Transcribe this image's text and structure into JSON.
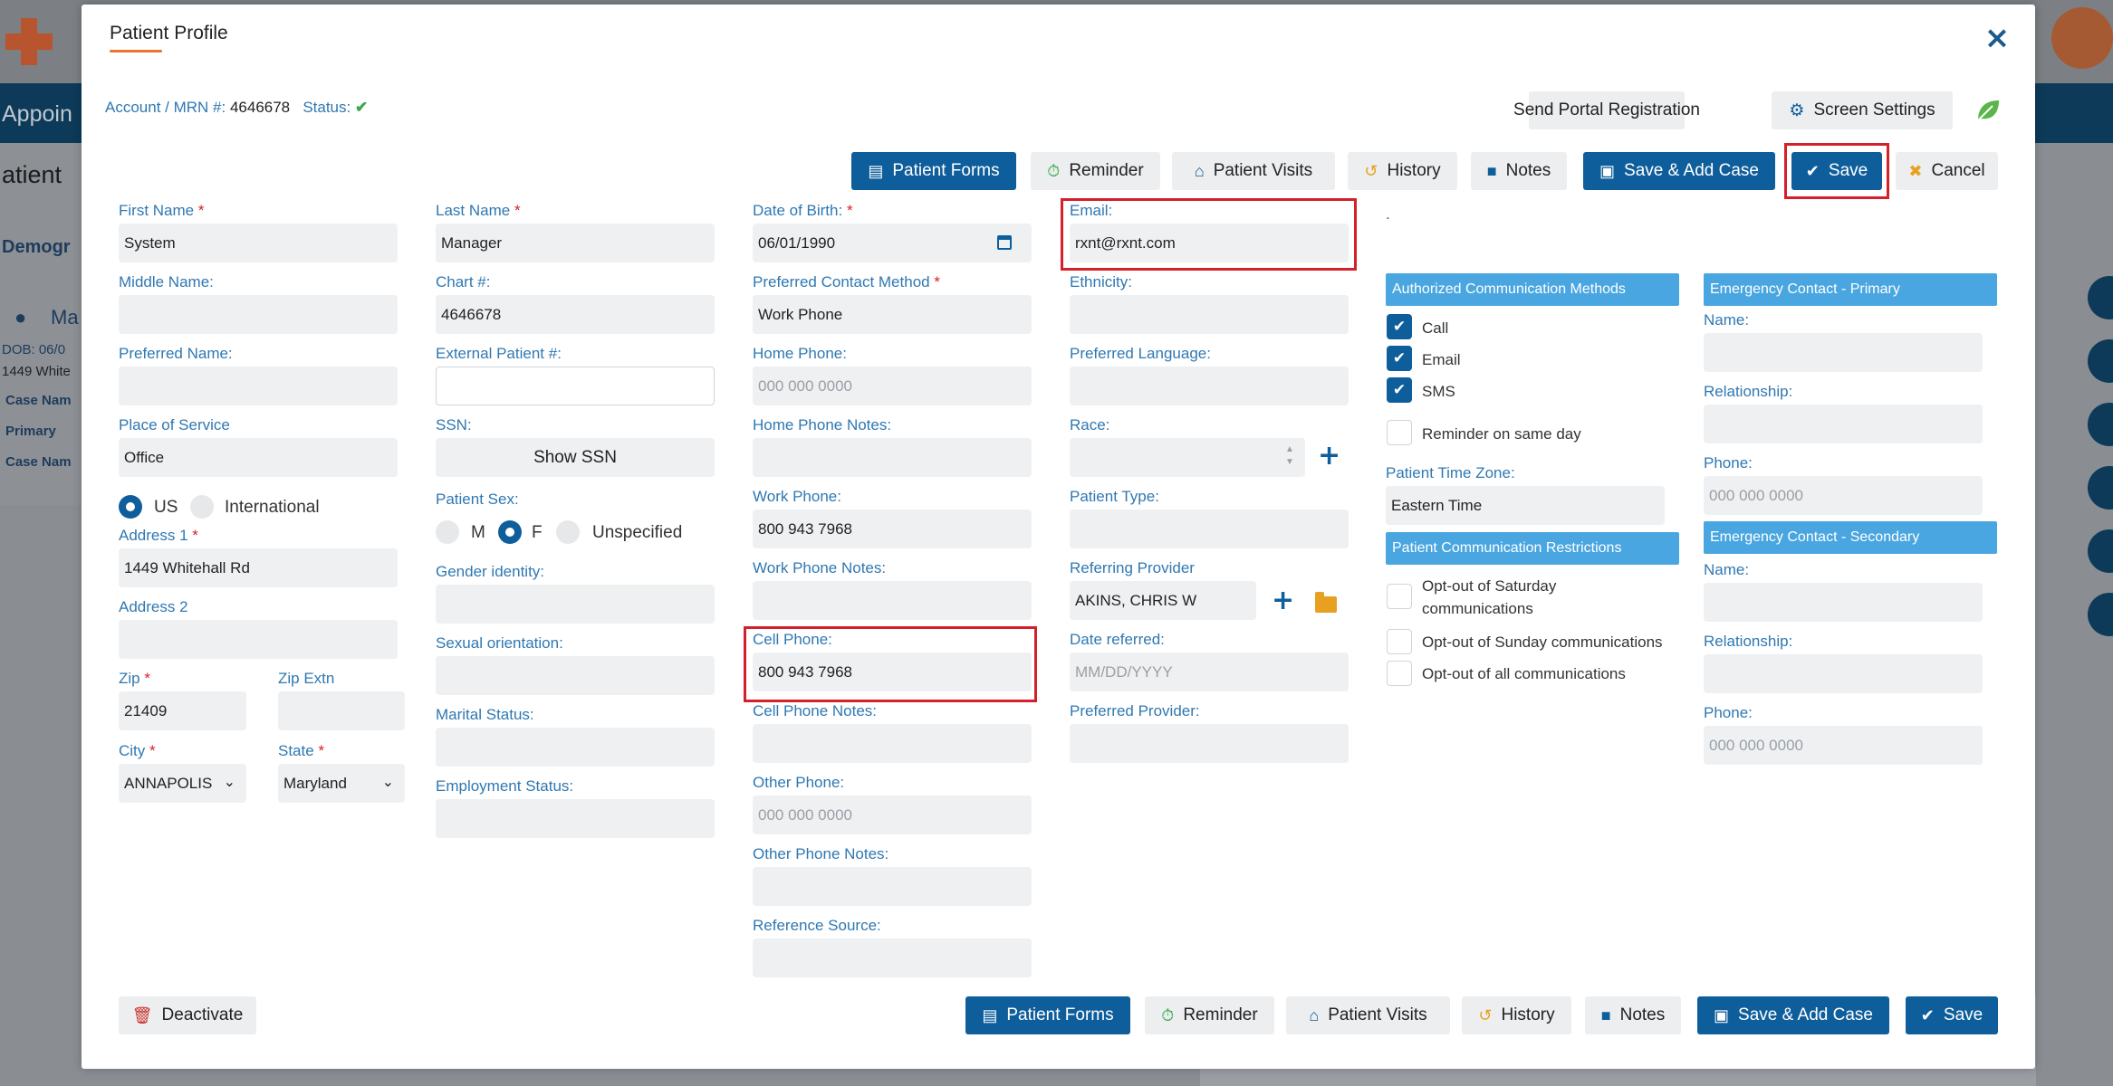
{
  "background": {
    "nav_text": "Appoin",
    "page_title": "atient",
    "tab": "Demogr",
    "side": [
      "DOB: 06/0",
      "1449 White",
      "Case Nam",
      "Primary",
      "Case Nam"
    ],
    "patient_name": "Ma"
  },
  "modal": {
    "title": "Patient Profile",
    "account_label": "Account / MRN #:",
    "account_value": "4646678",
    "status_label": "Status:"
  },
  "header_buttons": {
    "send_portal": "Send Portal Registration",
    "screen_settings": "Screen Settings"
  },
  "toolbar": {
    "patient_forms": "Patient Forms",
    "reminder": "Reminder",
    "patient_visits": "Patient Visits",
    "history": "History",
    "notes": "Notes",
    "save_add_case": "Save & Add Case",
    "save": "Save",
    "cancel": "Cancel"
  },
  "col1": {
    "first_name_label": "First Name",
    "first_name": "System",
    "middle_name_label": "Middle Name:",
    "middle_name": "",
    "preferred_name_label": "Preferred Name:",
    "preferred_name": "",
    "place_of_service_label": "Place of Service",
    "place_of_service": "Office",
    "radio_us": "US",
    "radio_intl": "International",
    "address1_label": "Address 1",
    "address1": "1449 Whitehall Rd",
    "address2_label": "Address 2",
    "address2": "",
    "zip_label": "Zip",
    "zip": "21409",
    "zip_extn_label": "Zip Extn",
    "zip_extn": "",
    "city_label": "City",
    "city": "ANNAPOLIS",
    "state_label": "State",
    "state": "Maryland"
  },
  "col2": {
    "last_name_label": "Last Name",
    "last_name": "Manager",
    "chart_label": "Chart #:",
    "chart": "4646678",
    "external_label": "External Patient #:",
    "external": "",
    "ssn_label": "SSN:",
    "show_ssn": "Show SSN",
    "sex_label": "Patient Sex:",
    "sex_m": "M",
    "sex_f": "F",
    "sex_u": "Unspecified",
    "gender_label": "Gender identity:",
    "sexual_label": "Sexual orientation:",
    "marital_label": "Marital Status:",
    "employment_label": "Employment Status:"
  },
  "col3": {
    "dob_label": "Date of Birth:",
    "dob": "06/01/1990",
    "contact_method_label": "Preferred Contact Method",
    "contact_method": "Work Phone",
    "home_phone_label": "Home Phone:",
    "home_phone_placeholder": "000 000 0000",
    "home_notes_label": "Home Phone Notes:",
    "work_phone_label": "Work Phone:",
    "work_phone": "800 943 7968",
    "work_notes_label": "Work Phone Notes:",
    "cell_phone_label": "Cell Phone:",
    "cell_phone": "800 943 7968",
    "cell_notes_label": "Cell Phone Notes:",
    "other_phone_label": "Other Phone:",
    "other_phone_placeholder": "000 000 0000",
    "other_notes_label": "Other Phone Notes:",
    "reference_label": "Reference Source:"
  },
  "col4": {
    "email_label": "Email:",
    "email": "rxnt@rxnt.com",
    "ethnicity_label": "Ethnicity:",
    "language_label": "Preferred Language:",
    "race_label": "Race:",
    "patient_type_label": "Patient Type:",
    "referring_label": "Referring Provider",
    "referring": "AKINS, CHRIS W",
    "date_referred_label": "Date referred:",
    "date_referred_placeholder": "MM/DD/YYYY",
    "preferred_provider_label": "Preferred Provider:"
  },
  "col5": {
    "dot": ".",
    "auth_methods_head": "Authorized Communication Methods",
    "call": "Call",
    "email": "Email",
    "sms": "SMS",
    "reminder_same_day": "Reminder on same day",
    "timezone_label": "Patient Time Zone:",
    "timezone": "Eastern Time",
    "restrictions_head": "Patient Communication Restrictions",
    "opt_saturday": "Opt-out of Saturday communications",
    "opt_sunday": "Opt-out of Sunday communications",
    "opt_all": "Opt-out of all communications"
  },
  "col6": {
    "primary_head": "Emergency Contact - Primary",
    "name_label": "Name:",
    "relationship_label": "Relationship:",
    "phone_label": "Phone:",
    "phone_placeholder": "000 000 0000",
    "secondary_head": "Emergency Contact - Secondary",
    "name2_label": "Name:",
    "relationship2_label": "Relationship:",
    "phone2_label": "Phone:",
    "phone2_placeholder": "000 000 0000"
  },
  "footer": {
    "deactivate": "Deactivate",
    "patient_forms": "Patient Forms",
    "reminder": "Reminder",
    "patient_visits": "Patient Visits",
    "history": "History",
    "notes": "Notes",
    "save_add_case": "Save & Add Case",
    "save": "Save"
  },
  "colors": {
    "primary": "#0f5e9c",
    "label": "#2f78b2",
    "highlight": "#d3202a",
    "section_head": "#4aa6e0",
    "accent": "#e8762c"
  },
  "icons": [
    "close-icon",
    "check-icon",
    "gear-icon",
    "leaf-icon",
    "form-icon",
    "stopwatch-icon",
    "home-icon",
    "history-icon",
    "note-icon",
    "briefcase-icon",
    "x-icon",
    "calendar-icon",
    "plus-icon",
    "folder-icon",
    "trash-icon",
    "user-icon"
  ]
}
